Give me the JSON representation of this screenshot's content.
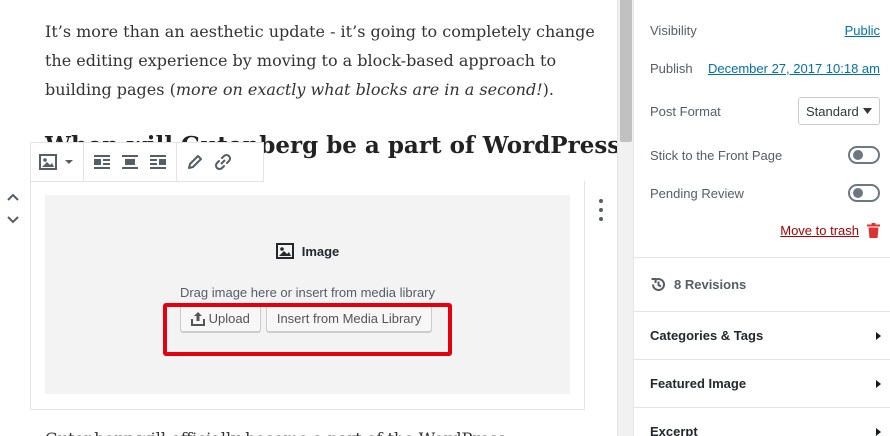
{
  "editor": {
    "para1_before_italic": "It’s more than an aesthetic update - it’s going to completely change the editing experience by moving to a block-based approach to building pages (",
    "para1_italic": "more on exactly what blocks are in a second!",
    "para1_after_italic": ").",
    "heading": "When will Gutenberg be a part of WordPress?",
    "para2": "Gutenberg will officially become a part of the WordPress"
  },
  "toolbar": {
    "icons": [
      "image-icon",
      "chevron-down-icon",
      "align-left-icon",
      "align-center-icon",
      "align-right-icon",
      "pencil-icon",
      "link-icon"
    ]
  },
  "image_block": {
    "title": "Image",
    "instructions": "Drag image here or insert from media library",
    "upload_label": "Upload",
    "media_library_label": "Insert from Media Library",
    "highlight_color": "#e3000f"
  },
  "sidebar": {
    "visibility_label": "Visibility",
    "visibility_value": "Public",
    "publish_label": "Publish",
    "publish_value": "December 27, 2017 10:18 am",
    "post_format_label": "Post Format",
    "post_format_value": "Standard",
    "sticky_label": "Stick to the Front Page",
    "pending_label": "Pending Review",
    "trash_label": "Move to trash",
    "revisions_label": "8 Revisions",
    "panels": [
      "Categories & Tags",
      "Featured Image",
      "Excerpt"
    ]
  },
  "colors": {
    "link": "#0073aa",
    "trash": "#a00",
    "highlight": "#e3000f"
  }
}
